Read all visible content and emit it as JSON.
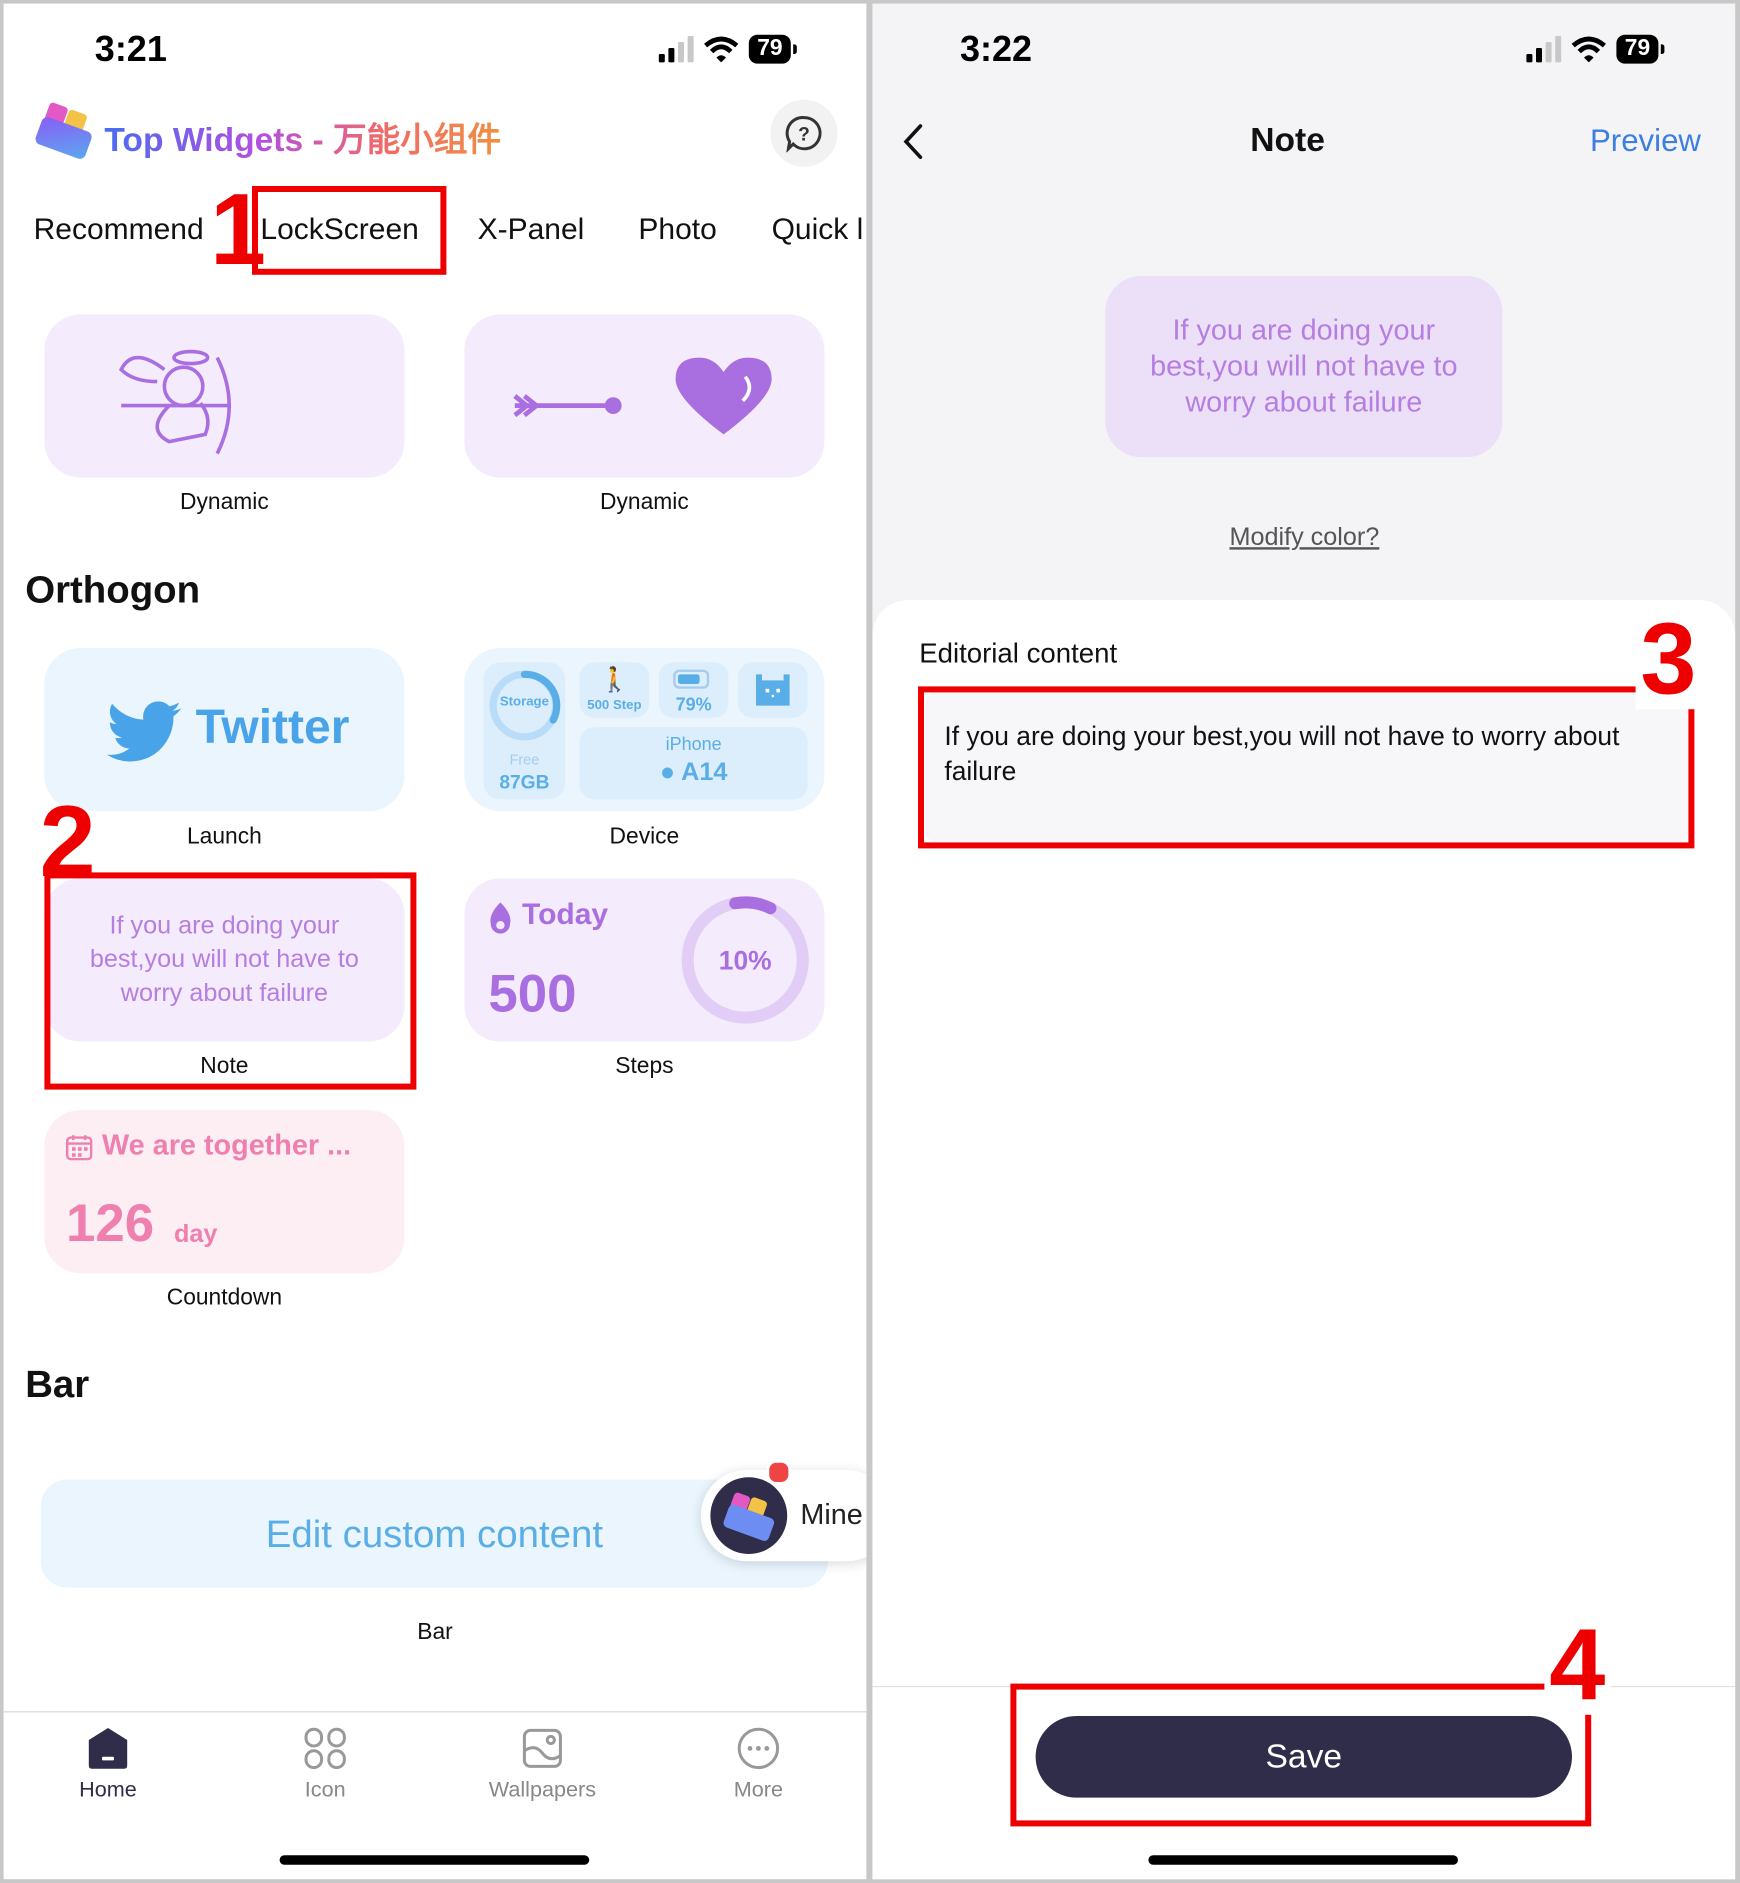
{
  "left_screen": {
    "status": {
      "time": "3:21",
      "battery": "79"
    },
    "app_title": "Top Widgets - 万能小组件",
    "help_icon": "question-bubble-icon",
    "tabs": [
      {
        "label": "Recommend"
      },
      {
        "label": "LockScreen",
        "selected": true
      },
      {
        "label": "X-Panel"
      },
      {
        "label": "Photo"
      },
      {
        "label": "Quick l"
      }
    ],
    "dynamic_row": [
      {
        "label": "Dynamic",
        "icon": "cupid-icon"
      },
      {
        "label": "Dynamic",
        "icon": "arrow-heart-icon"
      }
    ],
    "orthogon_title": "Orthogon",
    "twitter_widget": {
      "text": "Twitter",
      "label": "Launch"
    },
    "device_widget": {
      "storage": "Storage",
      "free": "Free",
      "free_value": "87GB",
      "steps": "500 Step",
      "battery": "79%",
      "phone": "iPhone",
      "chip": "A14",
      "label": "Device"
    },
    "note_widget": {
      "text": "If you are doing your best,you will not have to worry about failure",
      "label": "Note"
    },
    "steps_widget": {
      "today": "Today",
      "value": "500",
      "percent": "10%",
      "progress": 0.1,
      "label": "Steps"
    },
    "countdown_widget": {
      "title": "We are together ...",
      "value": "126",
      "unit": "day",
      "label": "Countdown"
    },
    "bar_title": "Bar",
    "bar_widget": {
      "text": "Edit custom content",
      "label": "Bar"
    },
    "mine_button": "Mine",
    "nav": [
      {
        "label": "Home",
        "icon": "home-icon",
        "active": true
      },
      {
        "label": "Icon",
        "icon": "icon-grid-icon"
      },
      {
        "label": "Wallpapers",
        "icon": "wallpaper-icon"
      },
      {
        "label": "More",
        "icon": "more-icon"
      }
    ]
  },
  "right_screen": {
    "status": {
      "time": "3:22",
      "battery": "79"
    },
    "title": "Note",
    "preview": "Preview",
    "preview_text": "If you are doing your best,you will not have to worry about failure",
    "modify_color": "Modify color?",
    "editorial_label": "Editorial content",
    "editorial_value": "If you are doing your best,you will not have to worry about failure",
    "save": "Save"
  },
  "annotations": [
    "1",
    "2",
    "3",
    "4"
  ],
  "colors": {
    "annotation": "#ee0000",
    "accent_purple": "#b57ee0",
    "preview_blue": "#3d7fe0",
    "save_bg": "#2f2d4a"
  }
}
